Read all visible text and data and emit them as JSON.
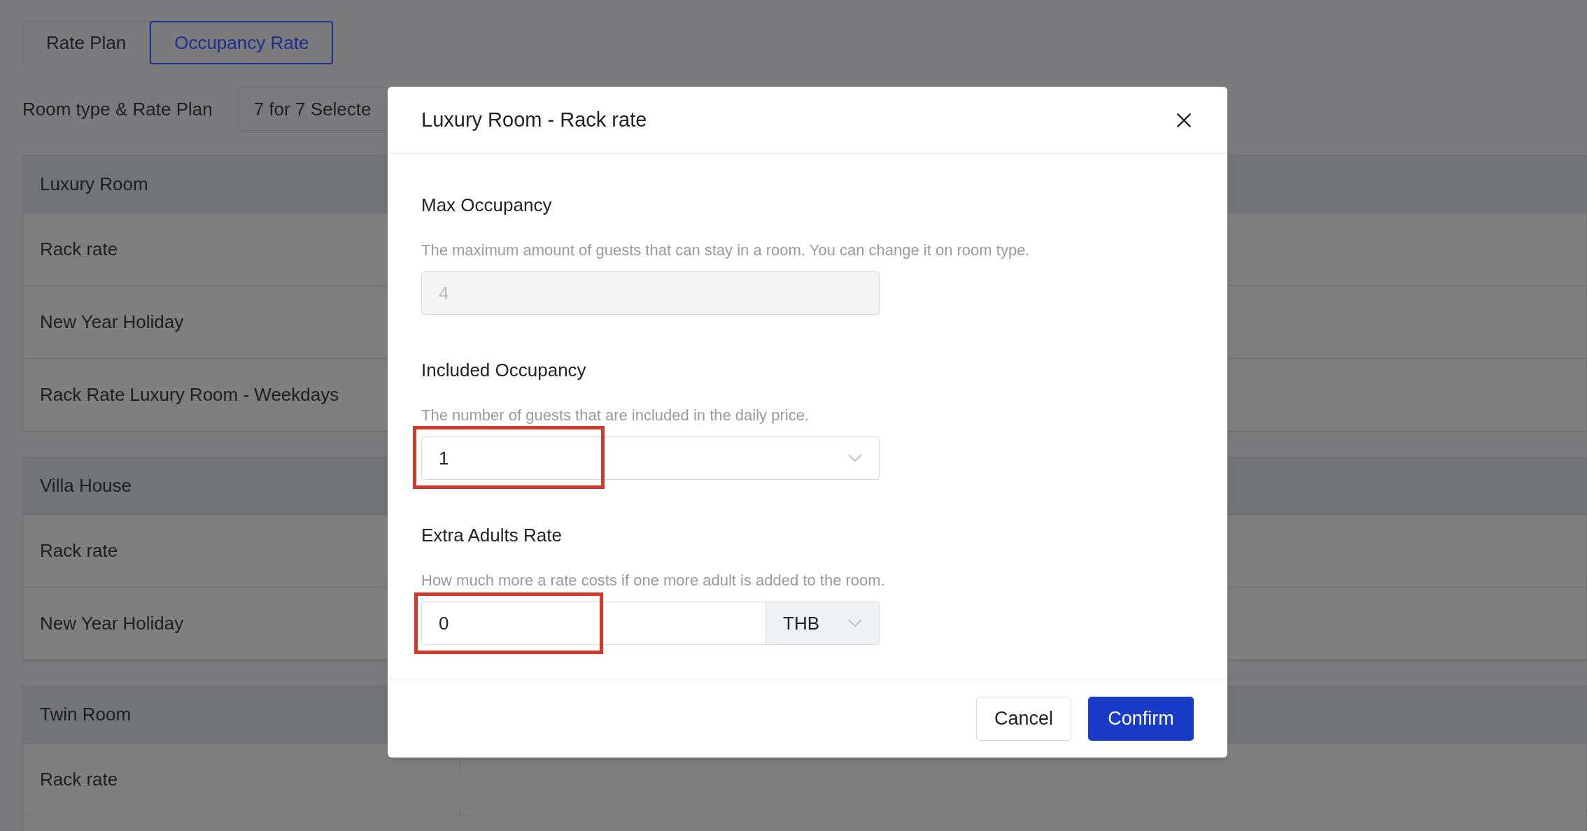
{
  "tabs": [
    {
      "label": "Rate Plan",
      "selected": false
    },
    {
      "label": "Occupancy Rate",
      "selected": true
    }
  ],
  "filter": {
    "label": "Room type & Rate Plan",
    "value": "7 for 7 Selecte"
  },
  "room_groups": [
    {
      "name": "Luxury Room",
      "rate_plans": [
        "Rack rate",
        "New Year Holiday",
        "Rack Rate Luxury Room - Weekdays"
      ]
    },
    {
      "name": "Villa House",
      "rate_plans": [
        "Rack rate",
        "New Year Holiday"
      ]
    },
    {
      "name": "Twin Room",
      "rate_plans": [
        "Rack rate"
      ],
      "more_rows_below": true
    }
  ],
  "dialog": {
    "title": "Luxury Room - Rack rate",
    "sections": [
      {
        "kind": "disabled",
        "title": "Max Occupancy",
        "description": "The maximum amount of guests that can stay in a room. You can change it on room type.",
        "value": "4",
        "highlighted": false
      },
      {
        "kind": "select",
        "title": "Included Occupancy",
        "description": "The number of guests that are included in the daily price.",
        "value": "1",
        "highlighted": true
      },
      {
        "kind": "currency",
        "title": "Extra Adults Rate",
        "description": "How much more a rate costs if one more adult is added to the room.",
        "value": "0",
        "currency": "THB",
        "highlighted": true
      }
    ],
    "buttons": [
      {
        "label": "Cancel",
        "kind": "secondary"
      },
      {
        "label": "Confirm",
        "kind": "primary"
      }
    ]
  }
}
